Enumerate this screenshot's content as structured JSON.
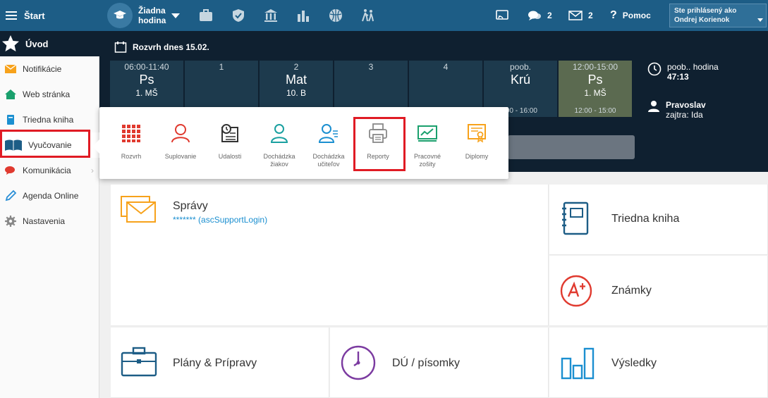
{
  "topbar": {
    "start_label": "Štart",
    "hour_line1": "Žiadna",
    "hour_line2": "hodina",
    "messages_count": "2",
    "mail_count": "2",
    "help_label": "Pomoc",
    "user_logged_label": "Ste prihlásený ako",
    "user_name": "Ondrej Korienok"
  },
  "today": {
    "title": "Rozvrh dnes 15.02."
  },
  "schedule": [
    {
      "time": "06:00-11:40",
      "subject": "Ps",
      "class": "1. MŠ",
      "bottom": ""
    },
    {
      "time": "1",
      "subject": "",
      "class": "",
      "bottom": ""
    },
    {
      "time": "2",
      "subject": "Mat",
      "class": "10. B",
      "bottom": ""
    },
    {
      "time": "3",
      "subject": "",
      "class": "",
      "bottom": ""
    },
    {
      "time": "4",
      "subject": "",
      "class": "",
      "bottom": ""
    },
    {
      "time": "poob.",
      "subject": "Krú",
      "class": "",
      "bottom": ":00 - 16:00"
    },
    {
      "time": "12:00-15:00",
      "subject": "Ps",
      "class": "1. MŠ",
      "bottom": "12:00 - 15:00"
    }
  ],
  "info": {
    "next_label": "poob.. hodina",
    "next_time": "47:13",
    "teacher": "Pravoslav",
    "tomorrow": "zajtra: Ida"
  },
  "sidebar": {
    "uvod": "Úvod",
    "items": [
      {
        "label": "Notifikácie"
      },
      {
        "label": "Web stránka"
      },
      {
        "label": "Triedna kniha"
      },
      {
        "label": "Vyučovanie"
      },
      {
        "label": "Komunikácia"
      },
      {
        "label": "Agenda Online"
      },
      {
        "label": "Nastavenia"
      }
    ]
  },
  "popup": {
    "items": [
      {
        "line1": "Rozvrh",
        "line2": ""
      },
      {
        "line1": "Suplovanie",
        "line2": ""
      },
      {
        "line1": "Udalosti",
        "line2": ""
      },
      {
        "line1": "Dochádzka",
        "line2": "žiakov"
      },
      {
        "line1": "Dochádzka",
        "line2": "učiteľov"
      },
      {
        "line1": "Reporty",
        "line2": ""
      },
      {
        "line1": "Pracovné",
        "line2": "zošity"
      },
      {
        "line1": "Diplomy",
        "line2": ""
      }
    ]
  },
  "tiles": {
    "spravy_title": "Správy",
    "spravy_sub": "******* (ascSupportLogin)",
    "triedna_kniha": "Triedna kniha",
    "znamky": "Známky",
    "plany": "Plány & Prípravy",
    "du": "DÚ / písomky",
    "vysledky": "Výsledky"
  },
  "colors": {
    "topbar": "#1d5d86",
    "dark_area": "#0f2030",
    "highlight": "#e01b24",
    "link": "#1b8fd0"
  }
}
